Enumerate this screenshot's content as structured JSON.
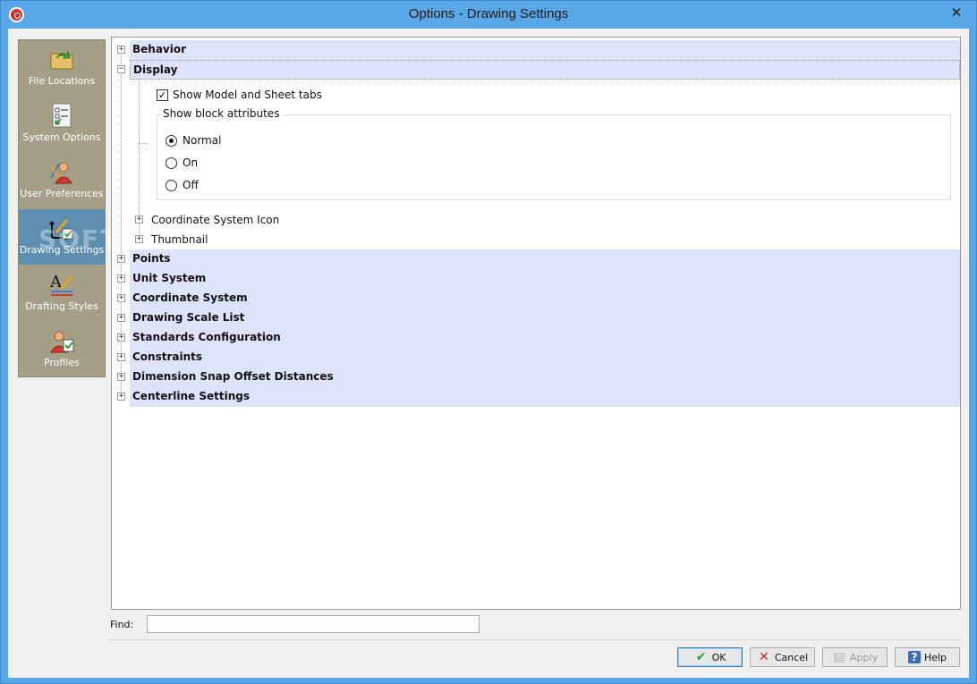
{
  "window": {
    "title": "Options - Drawing Settings",
    "close_glyph": "✕"
  },
  "nav": {
    "items": [
      {
        "label": "File Locations",
        "icon": "folder-arrow-icon"
      },
      {
        "label": "System Options",
        "icon": "checklist-icon"
      },
      {
        "label": "User Preferences",
        "icon": "user-preferences-icon"
      },
      {
        "label": "Drawing Settings",
        "icon": "drawing-settings-icon",
        "active": true
      },
      {
        "label": "Drafting Styles",
        "icon": "drafting-styles-icon"
      },
      {
        "label": "Profiles",
        "icon": "profiles-icon"
      }
    ],
    "watermark": "SOFTPEDIA"
  },
  "tree": {
    "behavior": "Behavior",
    "display": "Display",
    "show_model_sheet_tabs": "Show Model and Sheet tabs",
    "show_model_sheet_tabs_checked": true,
    "show_block_attributes": "Show block attributes",
    "radio_normal": "Normal",
    "radio_on": "On",
    "radio_off": "Off",
    "selected_radio": "Normal",
    "coordinate_system_icon": "Coordinate System Icon",
    "thumbnail": "Thumbnail",
    "categories": [
      "Points",
      "Unit System",
      "Coordinate System",
      "Drawing Scale List",
      "Standards Configuration",
      "Constraints",
      "Dimension Snap Offset Distances",
      "Centerline Settings"
    ]
  },
  "find": {
    "label": "Find:",
    "value": ""
  },
  "buttons": {
    "ok": "OK",
    "cancel": "Cancel",
    "apply": "Apply",
    "help": "Help"
  },
  "colors": {
    "title_bar": "#5aa7e7",
    "nav_bg": "#a59f88",
    "nav_active": "#5e8fb1",
    "category_bg": "#dfe2fb"
  }
}
